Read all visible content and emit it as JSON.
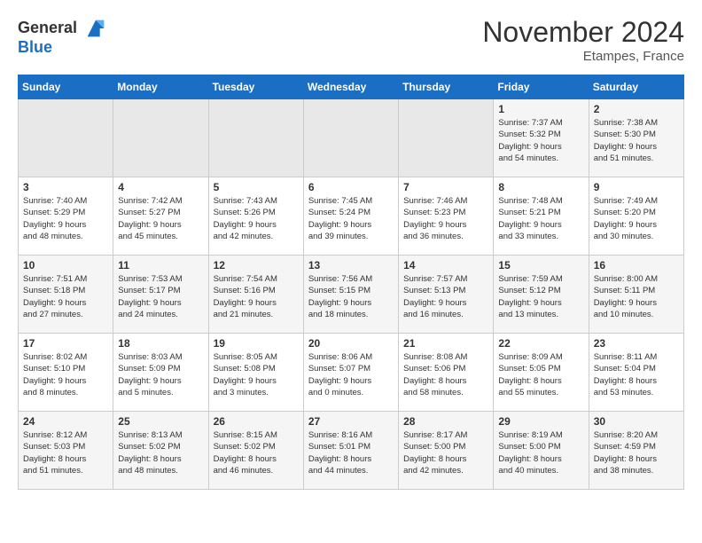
{
  "logo": {
    "line1": "General",
    "line2": "Blue"
  },
  "title": "November 2024",
  "location": "Etampes, France",
  "weekdays": [
    "Sunday",
    "Monday",
    "Tuesday",
    "Wednesday",
    "Thursday",
    "Friday",
    "Saturday"
  ],
  "weeks": [
    [
      {
        "day": "",
        "info": ""
      },
      {
        "day": "",
        "info": ""
      },
      {
        "day": "",
        "info": ""
      },
      {
        "day": "",
        "info": ""
      },
      {
        "day": "",
        "info": ""
      },
      {
        "day": "1",
        "info": "Sunrise: 7:37 AM\nSunset: 5:32 PM\nDaylight: 9 hours\nand 54 minutes."
      },
      {
        "day": "2",
        "info": "Sunrise: 7:38 AM\nSunset: 5:30 PM\nDaylight: 9 hours\nand 51 minutes."
      }
    ],
    [
      {
        "day": "3",
        "info": "Sunrise: 7:40 AM\nSunset: 5:29 PM\nDaylight: 9 hours\nand 48 minutes."
      },
      {
        "day": "4",
        "info": "Sunrise: 7:42 AM\nSunset: 5:27 PM\nDaylight: 9 hours\nand 45 minutes."
      },
      {
        "day": "5",
        "info": "Sunrise: 7:43 AM\nSunset: 5:26 PM\nDaylight: 9 hours\nand 42 minutes."
      },
      {
        "day": "6",
        "info": "Sunrise: 7:45 AM\nSunset: 5:24 PM\nDaylight: 9 hours\nand 39 minutes."
      },
      {
        "day": "7",
        "info": "Sunrise: 7:46 AM\nSunset: 5:23 PM\nDaylight: 9 hours\nand 36 minutes."
      },
      {
        "day": "8",
        "info": "Sunrise: 7:48 AM\nSunset: 5:21 PM\nDaylight: 9 hours\nand 33 minutes."
      },
      {
        "day": "9",
        "info": "Sunrise: 7:49 AM\nSunset: 5:20 PM\nDaylight: 9 hours\nand 30 minutes."
      }
    ],
    [
      {
        "day": "10",
        "info": "Sunrise: 7:51 AM\nSunset: 5:18 PM\nDaylight: 9 hours\nand 27 minutes."
      },
      {
        "day": "11",
        "info": "Sunrise: 7:53 AM\nSunset: 5:17 PM\nDaylight: 9 hours\nand 24 minutes."
      },
      {
        "day": "12",
        "info": "Sunrise: 7:54 AM\nSunset: 5:16 PM\nDaylight: 9 hours\nand 21 minutes."
      },
      {
        "day": "13",
        "info": "Sunrise: 7:56 AM\nSunset: 5:15 PM\nDaylight: 9 hours\nand 18 minutes."
      },
      {
        "day": "14",
        "info": "Sunrise: 7:57 AM\nSunset: 5:13 PM\nDaylight: 9 hours\nand 16 minutes."
      },
      {
        "day": "15",
        "info": "Sunrise: 7:59 AM\nSunset: 5:12 PM\nDaylight: 9 hours\nand 13 minutes."
      },
      {
        "day": "16",
        "info": "Sunrise: 8:00 AM\nSunset: 5:11 PM\nDaylight: 9 hours\nand 10 minutes."
      }
    ],
    [
      {
        "day": "17",
        "info": "Sunrise: 8:02 AM\nSunset: 5:10 PM\nDaylight: 9 hours\nand 8 minutes."
      },
      {
        "day": "18",
        "info": "Sunrise: 8:03 AM\nSunset: 5:09 PM\nDaylight: 9 hours\nand 5 minutes."
      },
      {
        "day": "19",
        "info": "Sunrise: 8:05 AM\nSunset: 5:08 PM\nDaylight: 9 hours\nand 3 minutes."
      },
      {
        "day": "20",
        "info": "Sunrise: 8:06 AM\nSunset: 5:07 PM\nDaylight: 9 hours\nand 0 minutes."
      },
      {
        "day": "21",
        "info": "Sunrise: 8:08 AM\nSunset: 5:06 PM\nDaylight: 8 hours\nand 58 minutes."
      },
      {
        "day": "22",
        "info": "Sunrise: 8:09 AM\nSunset: 5:05 PM\nDaylight: 8 hours\nand 55 minutes."
      },
      {
        "day": "23",
        "info": "Sunrise: 8:11 AM\nSunset: 5:04 PM\nDaylight: 8 hours\nand 53 minutes."
      }
    ],
    [
      {
        "day": "24",
        "info": "Sunrise: 8:12 AM\nSunset: 5:03 PM\nDaylight: 8 hours\nand 51 minutes."
      },
      {
        "day": "25",
        "info": "Sunrise: 8:13 AM\nSunset: 5:02 PM\nDaylight: 8 hours\nand 48 minutes."
      },
      {
        "day": "26",
        "info": "Sunrise: 8:15 AM\nSunset: 5:02 PM\nDaylight: 8 hours\nand 46 minutes."
      },
      {
        "day": "27",
        "info": "Sunrise: 8:16 AM\nSunset: 5:01 PM\nDaylight: 8 hours\nand 44 minutes."
      },
      {
        "day": "28",
        "info": "Sunrise: 8:17 AM\nSunset: 5:00 PM\nDaylight: 8 hours\nand 42 minutes."
      },
      {
        "day": "29",
        "info": "Sunrise: 8:19 AM\nSunset: 5:00 PM\nDaylight: 8 hours\nand 40 minutes."
      },
      {
        "day": "30",
        "info": "Sunrise: 8:20 AM\nSunset: 4:59 PM\nDaylight: 8 hours\nand 38 minutes."
      }
    ]
  ]
}
